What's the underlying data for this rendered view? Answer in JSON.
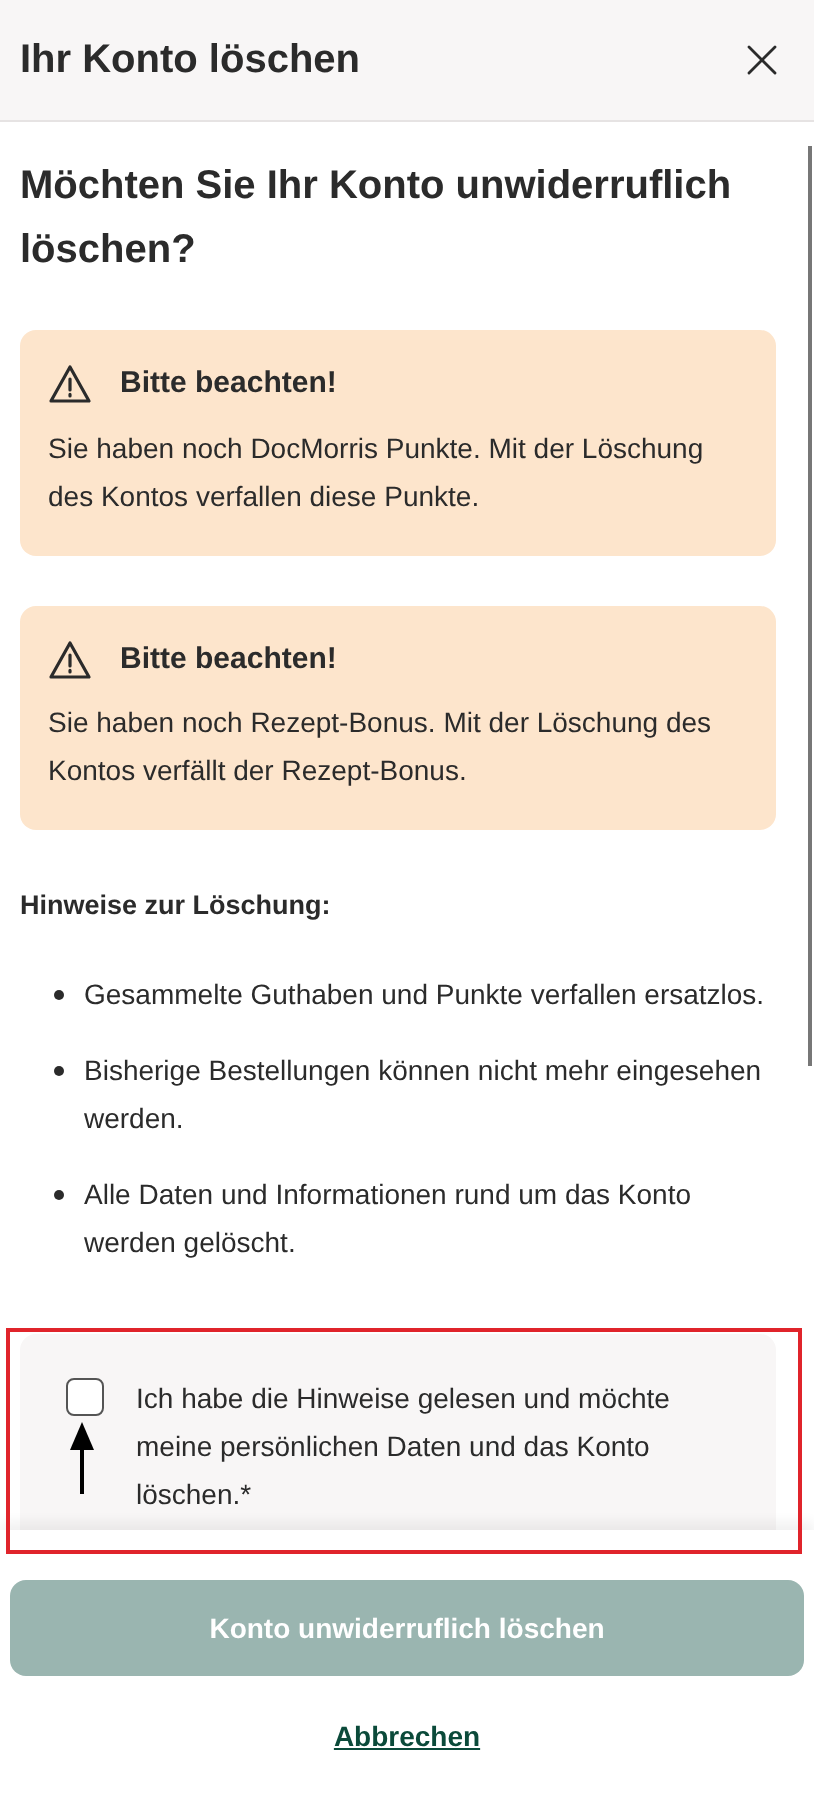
{
  "header": {
    "title": "Ihr Konto löschen"
  },
  "question": "Möchten Sie Ihr Konto unwiderruflich löschen?",
  "notices": [
    {
      "title": "Bitte beachten!",
      "text": "Sie haben noch DocMorris Punkte. Mit der Löschung des Kontos verfallen diese Punkte."
    },
    {
      "title": "Bitte beachten!",
      "text": "Sie haben noch Rezept-Bonus. Mit der Löschung des Kontos verfällt der Rezept-Bonus."
    }
  ],
  "hints": {
    "heading": "Hinweise zur Löschung:",
    "items": [
      "Gesammelte Guthaben und Punkte verfallen ersatzlos.",
      "Bisherige Bestellungen können nicht mehr eingesehen werden.",
      "Alle Daten und Informationen rund um das Konto werden gelöscht."
    ]
  },
  "consent": {
    "label": "Ich habe die Hinweise gelesen und möchte meine persönlichen Daten und das Konto löschen.*",
    "checked": false
  },
  "confirm_button": {
    "label": "Konto unwiderruflich löschen",
    "disabled": true
  },
  "cancel_link": "Abbrechen"
}
